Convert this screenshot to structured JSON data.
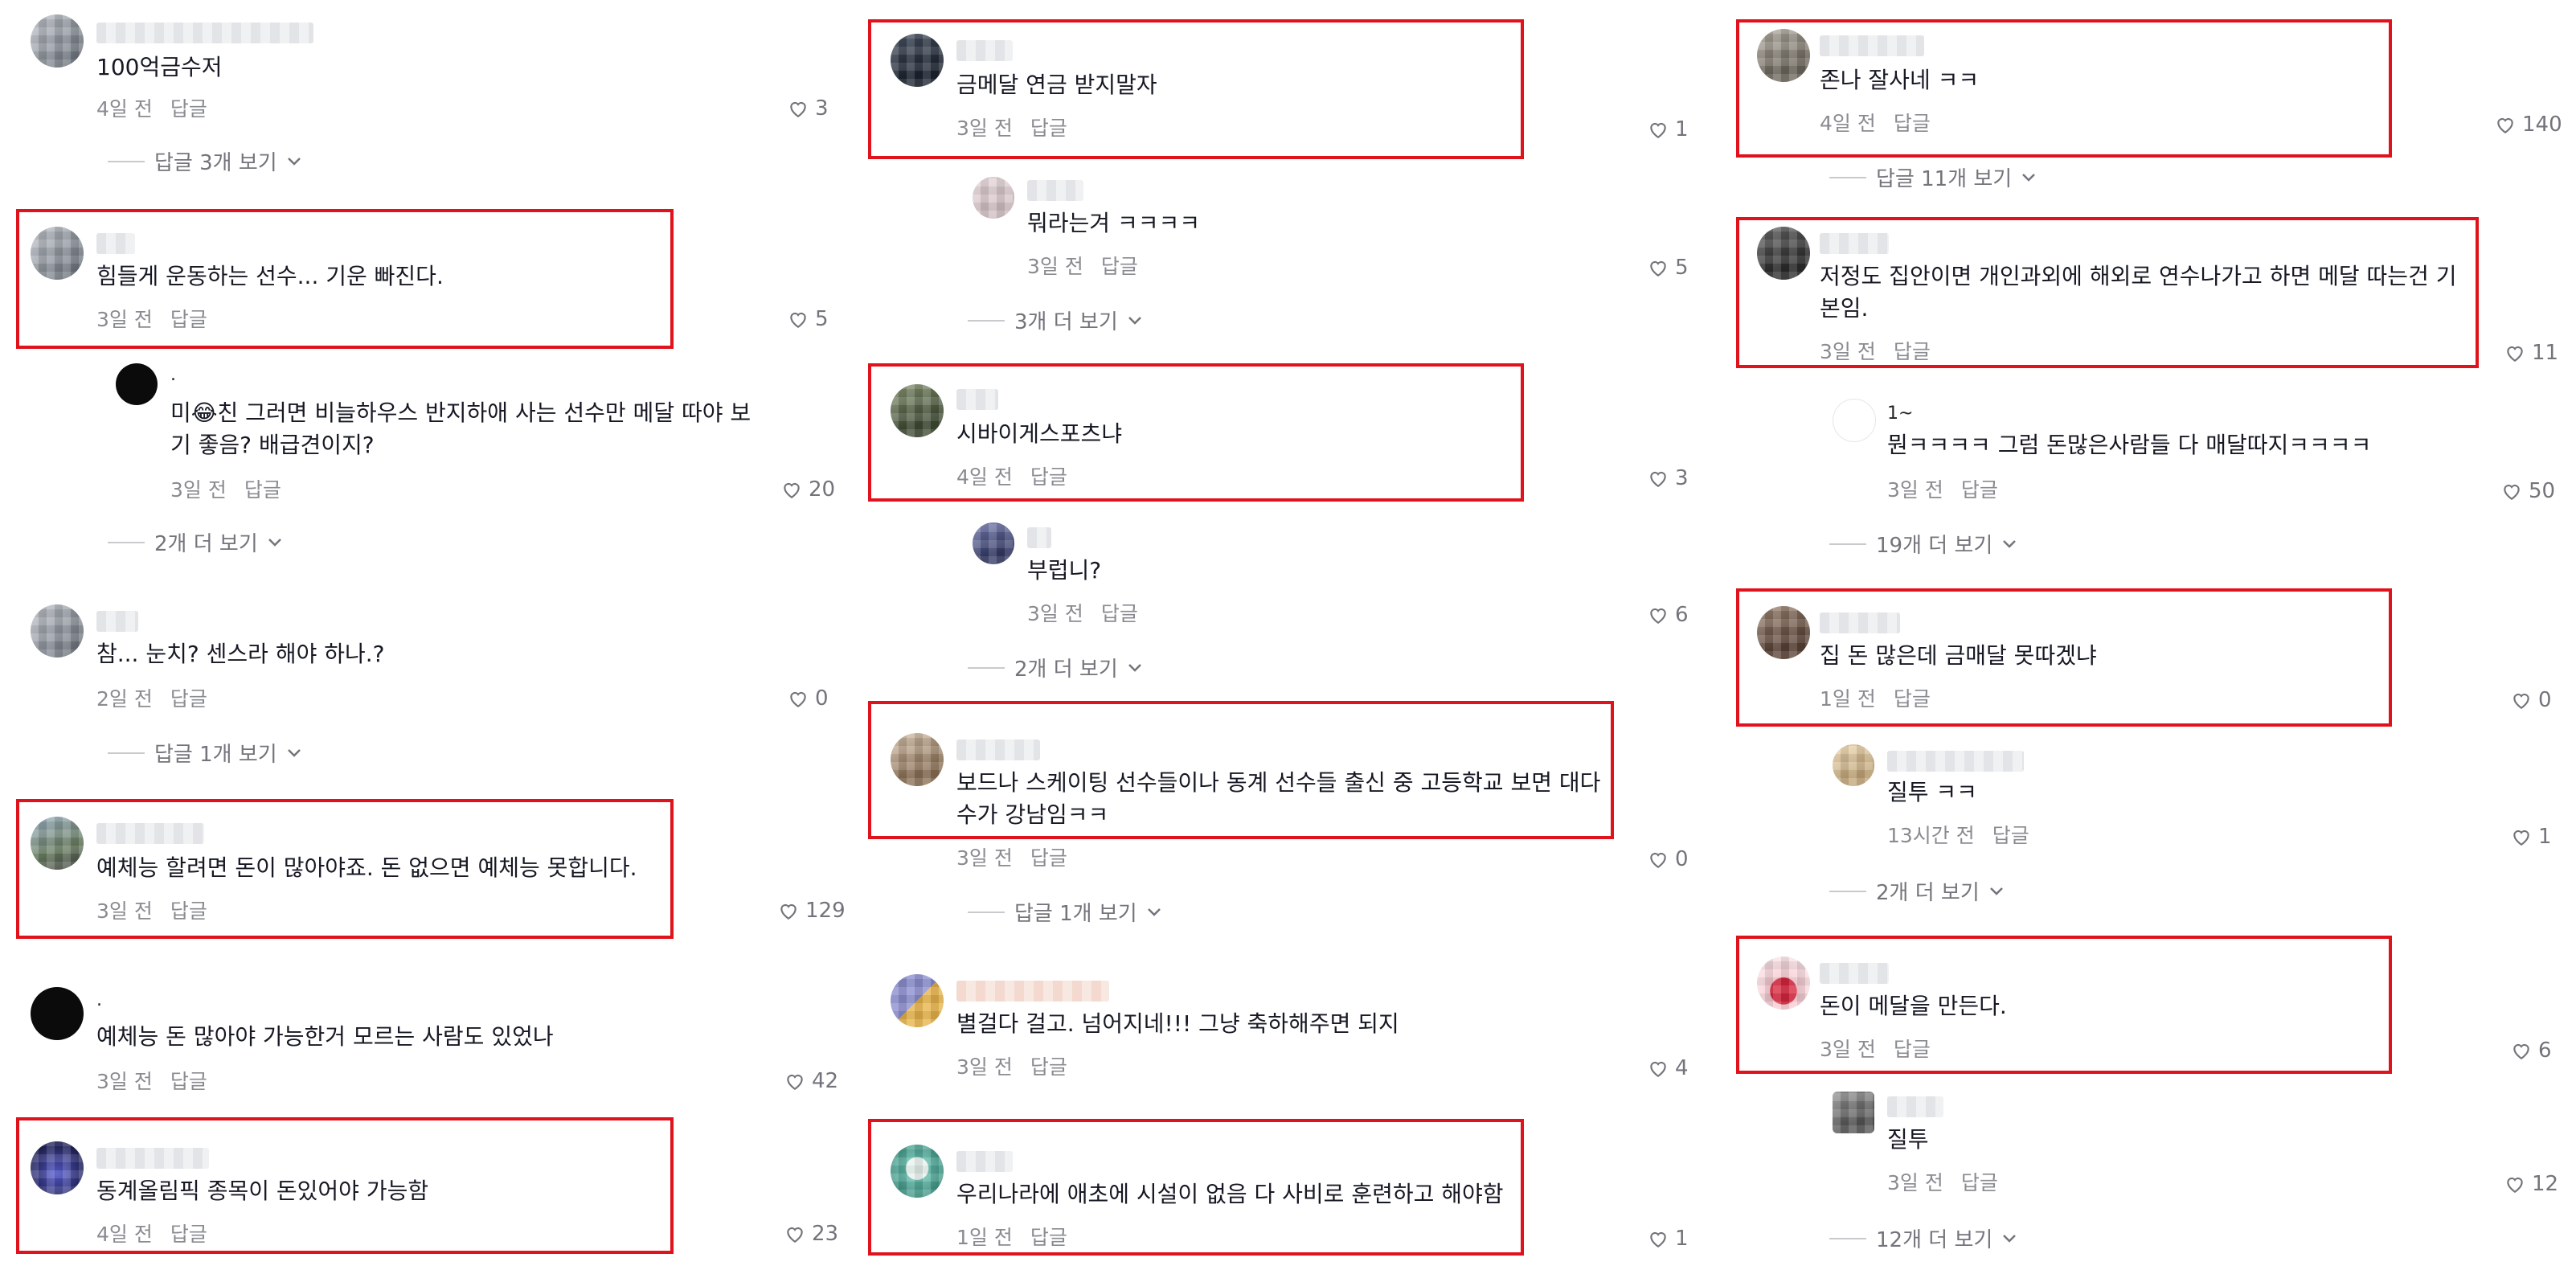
{
  "common": {
    "reply_label": "답글"
  },
  "comments": [
    {
      "id": "c1",
      "text": "100억금수저",
      "time": "4일 전",
      "likes": "3"
    },
    {
      "id": "c2",
      "text": "힘들게 운동하는 선수... 기운 빠진다.",
      "time": "3일 전",
      "likes": "5"
    },
    {
      "id": "c3",
      "username": ".",
      "text": "미😂친 그러면 비늘하우스 반지하애 사는 선수만 메달 따야 보기 좋음? 배급견이지?",
      "time": "3일 전",
      "likes": "20"
    },
    {
      "id": "c4",
      "text": "참... 눈치? 센스라 해야 하나.?",
      "time": "2일 전",
      "likes": "0"
    },
    {
      "id": "c5",
      "text": "예체능 할려면 돈이 많아야죠. 돈 없으면 예체능 못합니다.",
      "time": "3일 전",
      "likes": "129"
    },
    {
      "id": "c6",
      "username": ".",
      "text": "예체능 돈 많아야 가능한거 모르는 사람도 있었나",
      "time": "3일 전",
      "likes": "42"
    },
    {
      "id": "c7",
      "text": "동계올림픽 종목이 돈있어야 가능함",
      "time": "4일 전",
      "likes": "23"
    },
    {
      "id": "c8",
      "text": "금메달 연금 받지말자",
      "time": "3일 전",
      "likes": "1"
    },
    {
      "id": "c9",
      "text": "뭐라는겨 ㅋㅋㅋㅋ",
      "time": "3일 전",
      "likes": "5"
    },
    {
      "id": "c10",
      "text": "시바이게스포츠냐",
      "time": "4일 전",
      "likes": "3"
    },
    {
      "id": "c11",
      "text": "부럽니?",
      "time": "3일 전",
      "likes": "6"
    },
    {
      "id": "c12",
      "text": "보드나 스케이팅 선수들이나 동계 선수들 출신 중 고등학교 보면 대다수가 강남임ㅋㅋ",
      "time": "3일 전",
      "likes": "0"
    },
    {
      "id": "c13",
      "text": "별걸다 걸고. 넘어지네!!! 그냥 축하해주면 되지",
      "time": "3일 전",
      "likes": "4"
    },
    {
      "id": "c14",
      "text": "우리나라에 애초에 시설이 없음 다 사비로 훈련하고 해야함",
      "time": "1일 전",
      "likes": "1"
    },
    {
      "id": "c15",
      "text": "존나 잘사네 ㅋㅋ",
      "time": "4일 전",
      "likes": "140"
    },
    {
      "id": "c16",
      "text": "저정도 집안이면 개인과외에 해외로 연수나가고 하면 메달 따는건 기본임.",
      "time": "3일 전",
      "likes": "11"
    },
    {
      "id": "c17",
      "username": "1~",
      "text": "뭔ㅋㅋㅋㅋ 그럼 돈많은사람들 다 매달따지ㅋㅋㅋㅋ",
      "time": "3일 전",
      "likes": "50"
    },
    {
      "id": "c18",
      "text": "집 돈 많은데 금매달 못따겠냐",
      "time": "1일 전",
      "likes": "0"
    },
    {
      "id": "c19",
      "text": "질투 ㅋㅋ",
      "time": "13시간 전",
      "likes": "1"
    },
    {
      "id": "c20",
      "text": "돈이 메달을 만든다.",
      "time": "3일 전",
      "likes": "6"
    },
    {
      "id": "c21",
      "text": "질투",
      "time": "3일 전",
      "likes": "12"
    }
  ],
  "more_links": [
    {
      "id": "m1",
      "label": "답글 3개 보기"
    },
    {
      "id": "m2",
      "label": "2개 더 보기"
    },
    {
      "id": "m3",
      "label": "답글 1개 보기"
    },
    {
      "id": "m4",
      "label": "3개 더 보기"
    },
    {
      "id": "m5",
      "label": "2개 더 보기"
    },
    {
      "id": "m6",
      "label": "답글 1개 보기"
    },
    {
      "id": "m7",
      "label": "답글 11개 보기"
    },
    {
      "id": "m8",
      "label": "19개 더 보기"
    },
    {
      "id": "m9",
      "label": "2개 더 보기"
    },
    {
      "id": "m10",
      "label": "12개 더 보기"
    }
  ],
  "colors": {
    "highlight_box": "#e0121b",
    "meta_text": "#8a8b91",
    "like_icon": "#73747b"
  },
  "icons": {
    "like": "heart-outline-icon",
    "expand": "chevron-down-icon"
  }
}
